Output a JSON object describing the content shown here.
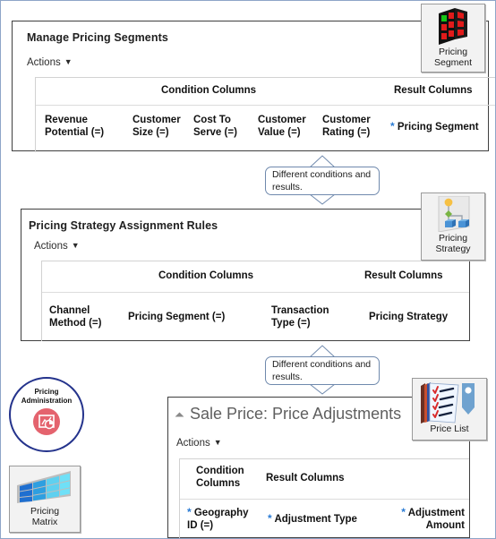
{
  "panels": [
    {
      "id": "manage-pricing-segments",
      "title": "Manage Pricing Segments",
      "actions_label": "Actions",
      "groups": [
        {
          "label": "Condition Columns"
        },
        {
          "label": "Result Columns"
        }
      ],
      "columns": [
        {
          "label": "Revenue\nPotential (=)",
          "required": false
        },
        {
          "label": "Customer\nSize (=)",
          "required": false
        },
        {
          "label": "Cost To\nServe (=)",
          "required": false
        },
        {
          "label": "Customer\nValue (=)",
          "required": false
        },
        {
          "label": "Customer\nRating (=)",
          "required": false
        },
        {
          "label": "Pricing Segment",
          "required": true
        }
      ]
    },
    {
      "id": "pricing-strategy-assignment-rules",
      "title": "Pricing Strategy Assignment Rules",
      "actions_label": "Actions",
      "groups": [
        {
          "label": "Condition Columns"
        },
        {
          "label": "Result Columns"
        }
      ],
      "columns": [
        {
          "label": "Channel\nMethod (=)",
          "required": false
        },
        {
          "label": "Pricing Segment (=)",
          "required": false
        },
        {
          "label": "Transaction\nType (=)",
          "required": false
        },
        {
          "label": "Pricing Strategy",
          "required": false
        }
      ]
    },
    {
      "id": "sale-price-price-adjustments",
      "title": "Sale Price: Price Adjustments",
      "actions_label": "Actions",
      "groups": [
        {
          "label": "Condition\nColumns"
        },
        {
          "label": "Result Columns"
        }
      ],
      "columns": [
        {
          "label": "Geography\nID (=)",
          "required": true
        },
        {
          "label": "Adjustment Type",
          "required": true
        },
        {
          "label": "Adjustment\nAmount",
          "required": true
        }
      ]
    }
  ],
  "callouts": [
    {
      "id": "callout-top",
      "text": "Different  conditions and results."
    },
    {
      "id": "callout-bottom",
      "text": "Different  conditions and results."
    }
  ],
  "icons": [
    {
      "id": "pricing-segment",
      "caption_line1": "Pricing",
      "caption_line2": "Segment"
    },
    {
      "id": "pricing-strategy",
      "caption_line1": "Pricing",
      "caption_line2": "Strategy"
    },
    {
      "id": "price-list",
      "caption_line1": "Price List",
      "caption_line2": ""
    },
    {
      "id": "pricing-matrix",
      "caption_line1": "Pricing",
      "caption_line2": "Matrix"
    }
  ],
  "badge": {
    "id": "pricing-administration",
    "caption_line1": "Pricing",
    "caption_line2": "Administration"
  },
  "colors": {
    "required_marker": "#2a7bd4",
    "panel_border": "#3f3f3f",
    "callout_border": "#6f89ad",
    "badge_ring": "#24338c",
    "badge_fill": "#e4636e",
    "frame_border": "#8ea5c8"
  }
}
